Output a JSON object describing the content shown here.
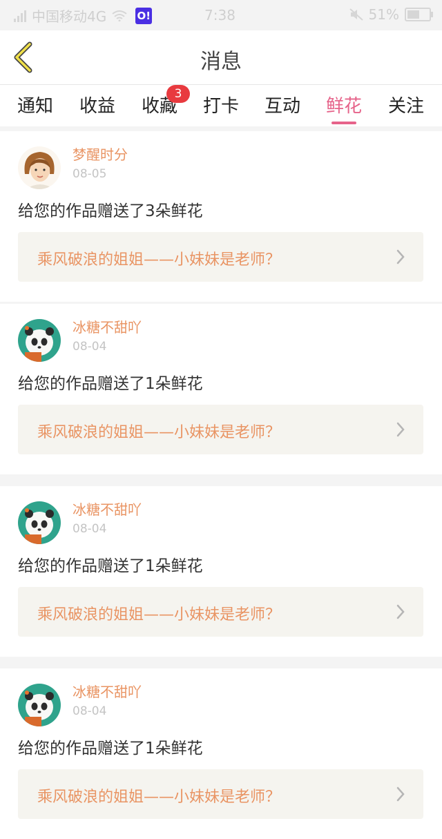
{
  "status_bar": {
    "carrier": "中国移动4G",
    "app_icon_text": "O!",
    "time": "7:38",
    "battery": "51%"
  },
  "header": {
    "title": "消息",
    "back_icon": "chevron-left-icon"
  },
  "tabs": [
    {
      "label": "通知"
    },
    {
      "label": "收益"
    },
    {
      "label": "收藏",
      "badge": "3"
    },
    {
      "label": "打卡"
    },
    {
      "label": "互动"
    },
    {
      "label": "鲜花",
      "active": true
    },
    {
      "label": "关注"
    }
  ],
  "messages": [
    {
      "name": "梦醒时分",
      "date": "08-05",
      "text": "给您的作品赠送了3朵鲜花",
      "work_title": "乘风破浪的姐姐——小妹妹是老师？"
    },
    {
      "name": "冰糖不甜吖",
      "date": "08-04",
      "text": "给您的作品赠送了1朵鲜花",
      "work_title": "乘风破浪的姐姐——小妹妹是老师？"
    },
    {
      "name": "冰糖不甜吖",
      "date": "08-04",
      "text": "给您的作品赠送了1朵鲜花",
      "work_title": "乘风破浪的姐姐——小妹妹是老师？"
    },
    {
      "name": "冰糖不甜吖",
      "date": "08-04",
      "text": "给您的作品赠送了1朵鲜花",
      "work_title": "乘风破浪的姐姐——小妹妹是老师？"
    }
  ],
  "colors": {
    "accent_pink": "#e6638a",
    "name_orange": "#e99463",
    "badge_red": "#e83a3f",
    "back_yellow": "#f0e04a"
  }
}
